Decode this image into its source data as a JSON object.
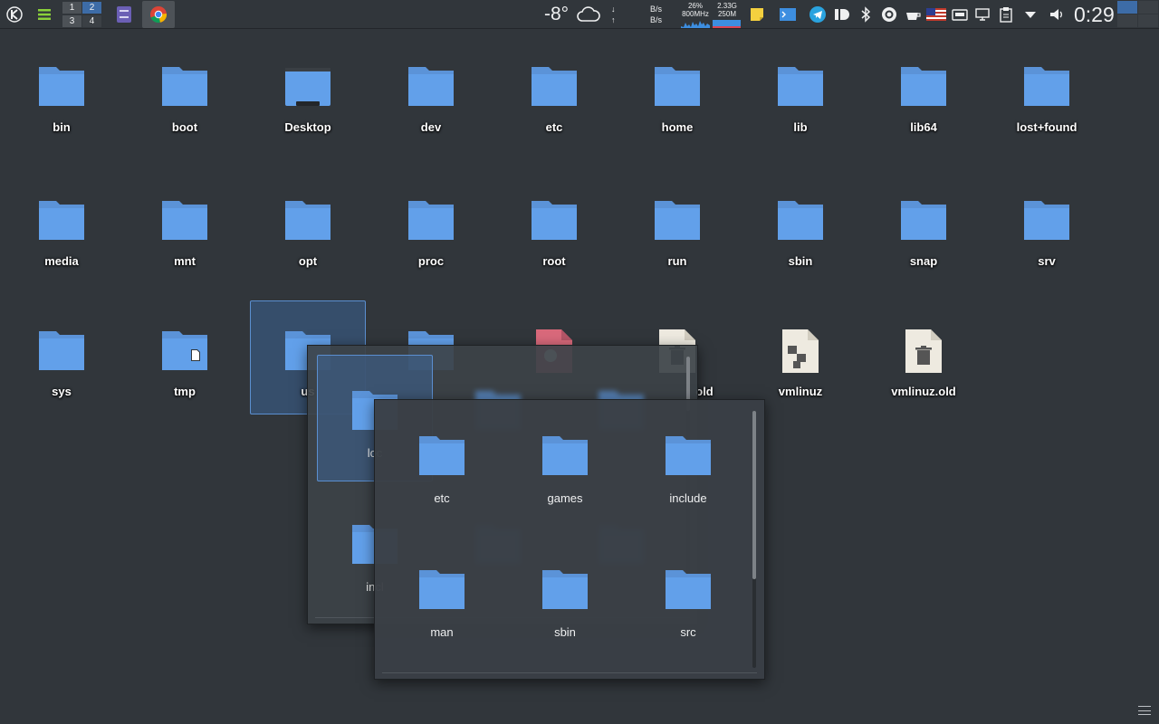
{
  "panel": {
    "pager": [
      "1",
      "2",
      "3",
      "4"
    ],
    "weather_temp": "-8°",
    "net_down": "↓",
    "net_up": "↑",
    "net_rate_down": "B/s",
    "net_rate_up": "B/s",
    "cpu_percent": "26%",
    "cpu_freq": "800MHz",
    "mem_total": "2.33G",
    "mem_used": "250M",
    "clock": "0:29"
  },
  "desktop": {
    "icons": [
      {
        "label": "bin",
        "type": "folder"
      },
      {
        "label": "boot",
        "type": "folder"
      },
      {
        "label": "Desktop",
        "type": "desktop-folder"
      },
      {
        "label": "dev",
        "type": "folder"
      },
      {
        "label": "etc",
        "type": "folder"
      },
      {
        "label": "home",
        "type": "folder"
      },
      {
        "label": "lib",
        "type": "folder"
      },
      {
        "label": "lib64",
        "type": "folder"
      },
      {
        "label": "lost+found",
        "type": "folder"
      },
      {
        "label": "media",
        "type": "folder"
      },
      {
        "label": "mnt",
        "type": "folder"
      },
      {
        "label": "opt",
        "type": "folder"
      },
      {
        "label": "proc",
        "type": "folder"
      },
      {
        "label": "root",
        "type": "folder"
      },
      {
        "label": "run",
        "type": "folder"
      },
      {
        "label": "sbin",
        "type": "folder"
      },
      {
        "label": "snap",
        "type": "folder"
      },
      {
        "label": "srv",
        "type": "folder"
      },
      {
        "label": "sys",
        "type": "folder"
      },
      {
        "label": "tmp",
        "type": "folder-doc"
      },
      {
        "label": "us",
        "type": "folder"
      },
      {
        "label": "vmlinuz",
        "type": "binary-file"
      },
      {
        "label": "vmlinuz.old",
        "type": "trash-file"
      }
    ],
    "partial_label_old": "old"
  },
  "popup_usr": {
    "items": [
      {
        "label": "loc"
      },
      {
        "label": "incl"
      }
    ]
  },
  "popup_local": {
    "items": [
      {
        "label": "etc"
      },
      {
        "label": "games"
      },
      {
        "label": "include"
      },
      {
        "label": "man"
      },
      {
        "label": "sbin"
      },
      {
        "label": "src"
      }
    ]
  },
  "colors": {
    "folder": "#62a0ea",
    "folder_tab": "#5b93d8",
    "selection": "#3d6ca7",
    "background": "#31363b"
  }
}
